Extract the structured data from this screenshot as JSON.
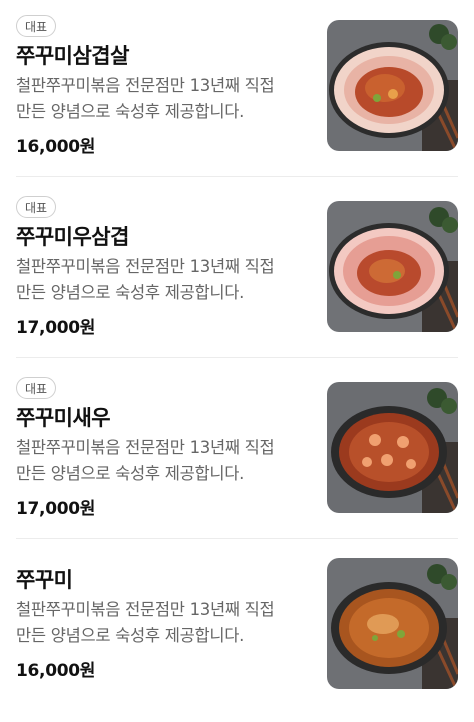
{
  "menu": {
    "items": [
      {
        "badge": "대표",
        "name": "쭈꾸미삼겹살",
        "desc_line1": "철판쭈꾸미볶음 전문점만 13년째 직접",
        "desc_line2": "만든 양념으로 숙성후 제공합니다.",
        "price": "16,000원",
        "image_icon": "food-photo-icon"
      },
      {
        "badge": "대표",
        "name": "쭈꾸미우삼겹",
        "desc_line1": "철판쭈꾸미볶음 전문점만 13년째 직접",
        "desc_line2": "만든 양념으로 숙성후 제공합니다.",
        "price": "17,000원",
        "image_icon": "food-photo-icon"
      },
      {
        "badge": "대표",
        "name": "쭈꾸미새우",
        "desc_line1": "철판쭈꾸미볶음 전문점만 13년째 직접",
        "desc_line2": "만든 양념으로 숙성후 제공합니다.",
        "price": "17,000원",
        "image_icon": "food-photo-icon"
      },
      {
        "badge": "",
        "name": "쭈꾸미",
        "desc_line1": "철판쭈꾸미볶음 전문점만 13년째 직접",
        "desc_line2": "만든 양념으로 숙성후 제공합니다.",
        "price": "16,000원",
        "image_icon": "food-photo-icon"
      }
    ]
  },
  "colors": {
    "text_primary": "#111111",
    "text_secondary": "#666666",
    "badge_border": "#cfcfcf",
    "divider": "#ececec"
  }
}
